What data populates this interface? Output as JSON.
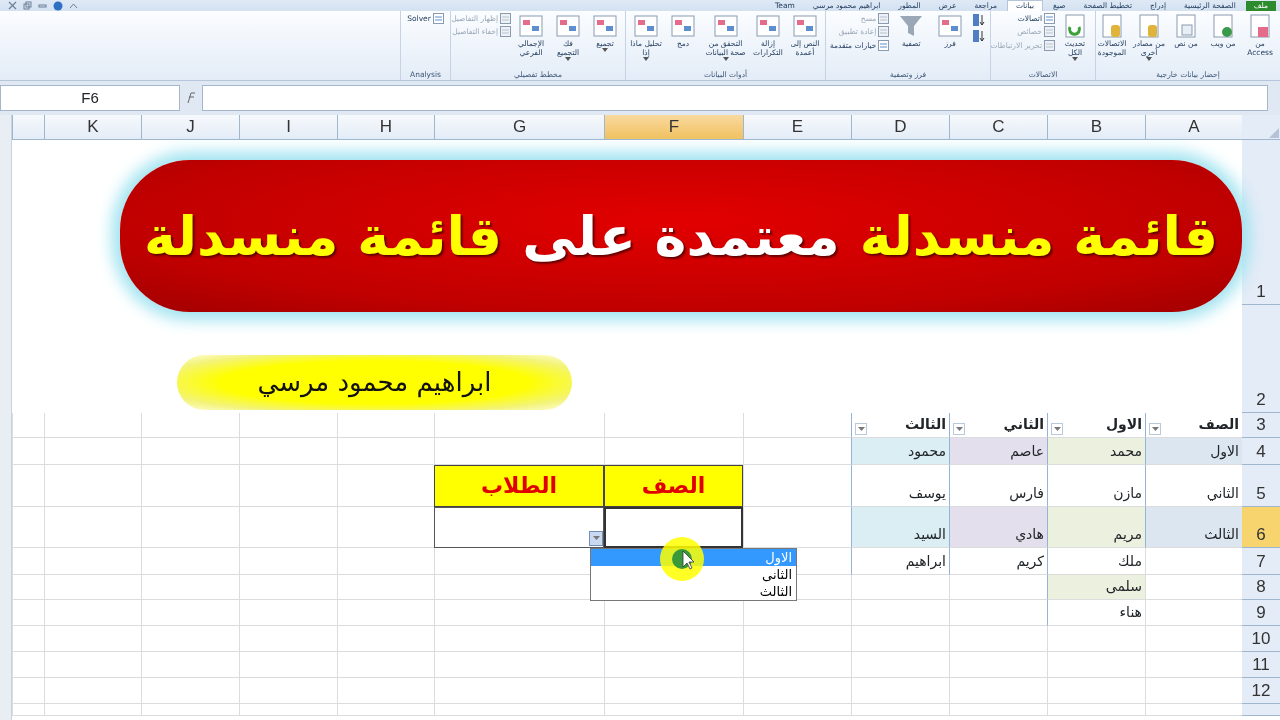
{
  "tabs": [
    {
      "label": "ملف",
      "selected": false,
      "kind": "file"
    },
    {
      "label": "الصفحة الرئيسية",
      "selected": false,
      "kind": "tab"
    },
    {
      "label": "إدراج",
      "selected": false,
      "kind": "tab"
    },
    {
      "label": "تخطيط الصفحة",
      "selected": false,
      "kind": "tab"
    },
    {
      "label": "صيغ",
      "selected": false,
      "kind": "tab"
    },
    {
      "label": "بيانات",
      "selected": true,
      "kind": "tab"
    },
    {
      "label": "مراجعة",
      "selected": false,
      "kind": "tab"
    },
    {
      "label": "عرض",
      "selected": false,
      "kind": "tab"
    },
    {
      "label": "المطور",
      "selected": false,
      "kind": "tab"
    },
    {
      "label": "ابراهيم محمود مرسي",
      "selected": false,
      "kind": "tab"
    },
    {
      "label": "Team",
      "selected": false,
      "kind": "tab"
    }
  ],
  "ribbon": {
    "groups": [
      {
        "label": "إحضار بيانات خارجية",
        "buttons": [
          {
            "label": "من Access",
            "kind": "large",
            "menu": false,
            "disabled": false
          },
          {
            "label": "من ويب",
            "kind": "large",
            "menu": false,
            "disabled": false
          },
          {
            "label": "من نص",
            "kind": "large",
            "menu": false,
            "disabled": false
          },
          {
            "label": "من مصادر أخرى",
            "kind": "large",
            "menu": true,
            "disabled": false
          },
          {
            "label": "الاتصالات الموجودة",
            "kind": "large",
            "menu": false,
            "disabled": false
          }
        ]
      },
      {
        "label": "الاتصالات",
        "buttons": [
          {
            "label": "تحديث الكل",
            "kind": "large",
            "menu": true,
            "disabled": false
          },
          {
            "label": "اتصالات",
            "kind": "small",
            "menu": false,
            "disabled": false
          },
          {
            "label": "خصائص",
            "kind": "small",
            "menu": false,
            "disabled": true
          },
          {
            "label": "تحرير الارتباطات",
            "kind": "small",
            "menu": false,
            "disabled": true
          }
        ]
      },
      {
        "label": "فرز وتصفية",
        "buttons": [
          {
            "kind": "icon",
            "menu": false,
            "disabled": false
          },
          {
            "kind": "icon",
            "menu": false,
            "disabled": false
          },
          {
            "label": "فرز",
            "kind": "large",
            "menu": false,
            "disabled": false
          },
          {
            "label": "تصفية",
            "kind": "large",
            "menu": false,
            "disabled": false
          },
          {
            "label": "مسح",
            "kind": "small",
            "menu": false,
            "disabled": true
          },
          {
            "label": "إعادة تطبيق",
            "kind": "small",
            "menu": false,
            "disabled": true
          },
          {
            "label": "خيارات متقدمة",
            "kind": "small",
            "menu": false,
            "disabled": false
          }
        ]
      },
      {
        "label": "أدوات البيانات",
        "buttons": [
          {
            "label": "النص إلى أعمدة",
            "kind": "large",
            "menu": false,
            "disabled": false
          },
          {
            "label": "إزالة التكرارات",
            "kind": "large",
            "menu": false,
            "disabled": false
          },
          {
            "label": "التحقق من صحة البيانات",
            "kind": "large",
            "menu": true,
            "disabled": false
          },
          {
            "label": "دمج",
            "kind": "large",
            "menu": false,
            "disabled": false
          },
          {
            "label": "تحليل ماذا إذا",
            "kind": "large",
            "menu": true,
            "disabled": false
          }
        ]
      },
      {
        "label": "مخطط تفصيلي",
        "buttons": [
          {
            "label": "تجميع",
            "kind": "large",
            "menu": true,
            "disabled": false
          },
          {
            "label": "فك التجميع",
            "kind": "large",
            "menu": true,
            "disabled": false
          },
          {
            "label": "الإجمالي الفرعي",
            "kind": "large",
            "menu": false,
            "disabled": false
          },
          {
            "label": "إظهار التفاصيل",
            "kind": "small",
            "menu": false,
            "disabled": true
          },
          {
            "label": "إخفاء التفاصيل",
            "kind": "small",
            "menu": false,
            "disabled": true
          }
        ]
      },
      {
        "label": "Analysis",
        "buttons": [
          {
            "label": "Solver",
            "kind": "small",
            "menu": false,
            "disabled": false
          }
        ]
      }
    ]
  },
  "formula_bar": {
    "name_box": "F6"
  },
  "sheet": {
    "columns": [
      {
        "label": "A",
        "selected": false
      },
      {
        "label": "B",
        "selected": false
      },
      {
        "label": "C",
        "selected": false
      },
      {
        "label": "D",
        "selected": false
      },
      {
        "label": "E",
        "selected": false
      },
      {
        "label": "F",
        "selected": true
      },
      {
        "label": "G",
        "selected": false
      },
      {
        "label": "H",
        "selected": false
      },
      {
        "label": "I",
        "selected": false
      },
      {
        "label": "J",
        "selected": false
      },
      {
        "label": "K",
        "selected": false
      }
    ],
    "rows": [
      {
        "label": "1",
        "selected": false
      },
      {
        "label": "2",
        "selected": false
      },
      {
        "label": "3",
        "selected": false
      },
      {
        "label": "4",
        "selected": false
      },
      {
        "label": "5",
        "selected": false
      },
      {
        "label": "6",
        "selected": true
      },
      {
        "label": "7",
        "selected": false
      },
      {
        "label": "8",
        "selected": false
      },
      {
        "label": "9",
        "selected": false
      },
      {
        "label": "10",
        "selected": false
      },
      {
        "label": "11",
        "selected": false
      },
      {
        "label": "12",
        "selected": false
      }
    ],
    "banner": {
      "parts": [
        {
          "text": "قائمة منسدلة",
          "color": "#ffff00"
        },
        {
          "text": "معتمدة على",
          "color": "#ffffff"
        },
        {
          "text": "قائمة منسدلة",
          "color": "#ffff00"
        }
      ]
    },
    "author_badge": {
      "text": "ابراهيم محمود مرسي"
    },
    "source_table": {
      "columns": [
        {
          "header": "الصف",
          "color": "#dce6f1",
          "values": [
            "الاول",
            "الثاني",
            "الثالث"
          ]
        },
        {
          "header": "الاول",
          "color": "#ebf1de",
          "values": [
            "محمد",
            "مازن",
            "مريم",
            "ملك",
            "سلمى",
            "هناء"
          ]
        },
        {
          "header": "الثاني",
          "color": "#e4dfec",
          "values": [
            "عاصم",
            "فارس",
            "هادي",
            "كريم"
          ]
        },
        {
          "header": "الثالث",
          "color": "#daeef3",
          "values": [
            "محمود",
            "يوسف",
            "السيد",
            "ابراهيم"
          ]
        }
      ]
    },
    "lookup_form": {
      "headers": [
        "الصف",
        "الطلاب"
      ],
      "dropdown": {
        "expanded": true,
        "options": [
          {
            "label": "الاول",
            "selected": true
          },
          {
            "label": "الثانى",
            "selected": false
          },
          {
            "label": "الثالث",
            "selected": false
          }
        ]
      }
    }
  }
}
